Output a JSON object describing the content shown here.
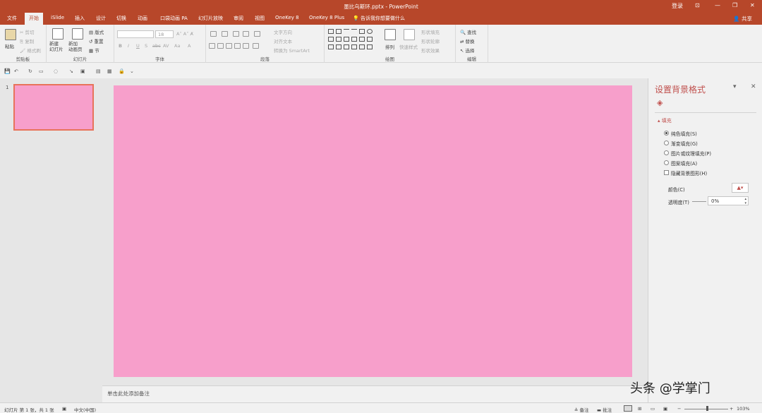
{
  "window": {
    "title": "墨比乌斯环.pptx - PowerPoint",
    "login": "登录"
  },
  "tabs": [
    "文件",
    "开始",
    "iSlide",
    "插入",
    "设计",
    "切换",
    "动画",
    "口袋动画 PA",
    "幻灯片放映",
    "审阅",
    "视图",
    "OneKey 8",
    "OneKey 8 Plus"
  ],
  "tell_me": "告诉我你想要做什么",
  "share": "共享",
  "ribbon": {
    "clipboard": {
      "paste": "粘贴",
      "cut": "剪切",
      "copy": "复制",
      "format_painter": "格式刷",
      "label": "剪贴板"
    },
    "slides": {
      "new_slide": "新建\n幻灯片",
      "new_anim_page": "新加\n动画页",
      "layout": "版式",
      "reset": "重置",
      "section": "节",
      "label": "幻灯片"
    },
    "font": {
      "label": "字体",
      "size": "18",
      "buttons": [
        "B",
        "I",
        "U",
        "S",
        "abc",
        "AV",
        "Aa",
        "A"
      ]
    },
    "paragraph": {
      "text_direction": "文字方向",
      "align_text": "对齐文本",
      "convert_smartart": "转换为 SmartArt",
      "label": "段落"
    },
    "drawing": {
      "arrange": "排列",
      "quick_styles": "快速样式",
      "shape_fill": "形状填充",
      "shape_outline": "形状轮廓",
      "shape_effects": "形状效果",
      "label": "绘图"
    },
    "editing": {
      "find": "查找",
      "replace": "替换",
      "select": "选择",
      "label": "编辑"
    }
  },
  "slides": [
    {
      "number": "1"
    }
  ],
  "slide_color": "#f79fcb",
  "accent_color": "#b7472a",
  "notes_placeholder": "单击此处添加备注",
  "format_pane": {
    "title": "设置背景格式",
    "section": "填充",
    "fill_options": [
      {
        "label": "纯色填充(S)",
        "selected": true
      },
      {
        "label": "渐变填充(G)",
        "selected": false
      },
      {
        "label": "图片或纹理填充(P)",
        "selected": false
      },
      {
        "label": "图案填充(A)",
        "selected": false
      }
    ],
    "hide_background_graphics": "隐藏背景图形(H)",
    "color_label": "颜色(C)",
    "transparency_label": "透明度(T)",
    "transparency_value": "0%"
  },
  "status": {
    "slide_info": "幻灯片 第 1 张，共 1 张",
    "language": "中文(中国)",
    "notes": "备注",
    "comments": "批注",
    "zoom": "103%"
  },
  "watermark": "头条 @学掌门"
}
